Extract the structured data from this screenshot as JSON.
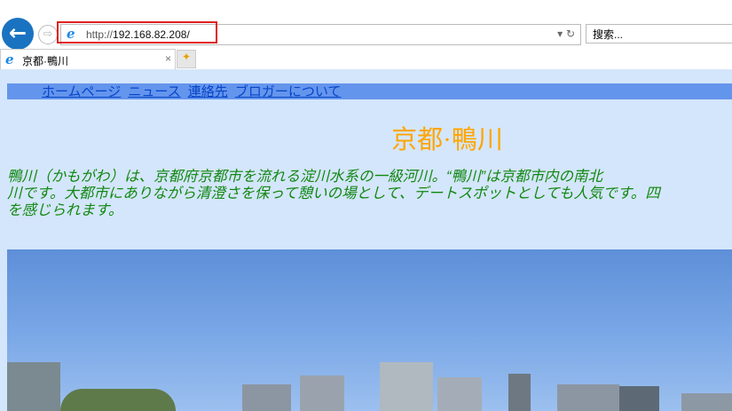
{
  "browser": {
    "url_scheme": "http://",
    "url_host": "192.168.82.208/",
    "search_placeholder": "搜索...",
    "tab_title": "京都·鴨川",
    "back": "←",
    "forward": "⇨",
    "dropdown": "▾",
    "refresh": "↻",
    "close": "×"
  },
  "page": {
    "menu": [
      "ホームページ",
      "ニュース",
      "連絡先",
      "ブロガーについて"
    ],
    "title": "京都·鴨川",
    "paragraph_lines": [
      "鴨川（かもがわ）は、京都府京都市を流れる淀川水系の一級河川。“鴨川”は京都市内の南北",
      "川です。大都市にありながら清澄さを保って憩いの場として、デートスポットとしても人気です。四",
      "を感じられます。"
    ]
  },
  "colors": {
    "page_bg": "#d4e6fb",
    "menu_bg": "#6495ed",
    "title": "#ffa500",
    "text": "#118811",
    "highlight": "#e02020"
  }
}
